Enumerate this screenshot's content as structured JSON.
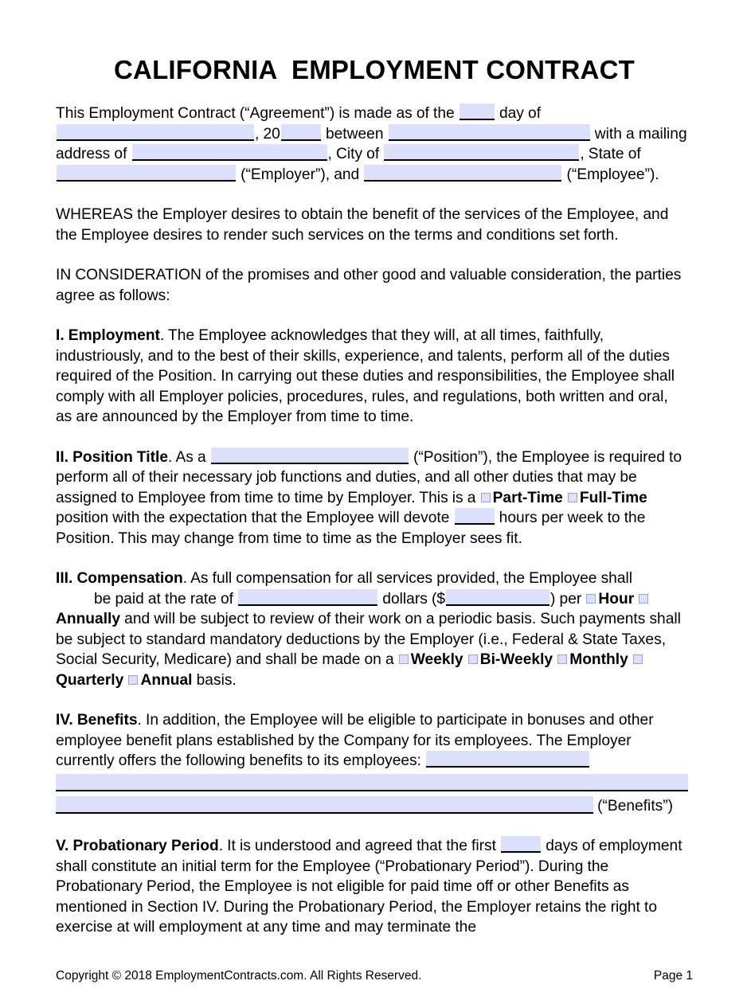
{
  "document": {
    "title": "CALIFORNIA  EMPLOYMENT CONTRACT",
    "state": "CALIFORNIA",
    "doc_type": "EMPLOYMENT CONTRACT"
  },
  "intro": {
    "t1": "This Employment Contract (“Agreement”) is made as of the",
    "t2": "day of",
    "t3": ", 20",
    "t4": "between",
    "t5": "with a mailing address of",
    "t6": ", City of",
    "t7": ", State of",
    "t8": "(“Employer”), and",
    "t9": "(“Employee”)."
  },
  "recitals": {
    "whereas": "WHEREAS the Employer desires to obtain the benefit of the services of the Employee, and the Employee desires to render such services on the terms and conditions set forth.",
    "consideration": "IN CONSIDERATION of the promises and other good and valuable consideration, the parties agree as follows:"
  },
  "sections": {
    "employment": {
      "heading": "I. Employment",
      "t1": ". The Employee acknowledges that they will, at all times, faithfully, industriously, and to the best of their skills, experience, and talents, perform all of the duties required of the Position. In carrying out these duties and responsibilities, the Employee shall comply with all Employer policies, procedures, rules, and regulations, both written and oral, as are announced by the Employer from time to time."
    },
    "position_title": {
      "heading": "II. Position Title",
      "t1": ". As a",
      "t2": "(“Position”), the Employee is required to perform all of their necessary job functions and duties, and all other duties that may be assigned to Employee from time to time by Employer. This is a",
      "opt_part_time": "Part-Time",
      "opt_full_time": "Full-Time",
      "t3": "position with the expectation that the Employee will devote",
      "t4": "hours per week to the Position. This may change from time to time as the Employer sees fit."
    },
    "compensation": {
      "heading": "III. Compensation",
      "t1": ". As full compensation for all services provided, the Employee shall",
      "t2": "be paid at the rate of",
      "t3": "dollars ($",
      "t4": ") per",
      "opt_hour": "Hour",
      "opt_annually": "Annually",
      "t5": "and will be subject to review of their work on a periodic basis. Such payments shall be subject to standard mandatory deductions by the Employer (i.e., Federal & State Taxes, Social Security, Medicare) and shall be made on a",
      "opt_weekly": "Weekly",
      "opt_biweekly": "Bi-Weekly",
      "opt_monthly": "Monthly",
      "opt_quarterly": "Quarterly",
      "opt_annual": "Annual",
      "t6": "basis."
    },
    "benefits": {
      "heading": "IV. Benefits",
      "t1": ". In addition, the Employee will be eligible to participate in bonuses and other employee benefit plans established by the Company for its employees. The Employer currently offers the following benefits to its employees:",
      "t2": "(“Benefits”)"
    },
    "probationary": {
      "heading": "V. Probationary Period",
      "t1": ". It is understood and agreed that the first",
      "t2": "days of employment shall constitute an initial term for the Employee (“Probationary Period”). During the Probationary Period, the Employee is not eligible for paid time off or other Benefits as mentioned in Section IV. During the Probationary Period, the Employer retains the right to exercise at will employment at any time and may terminate the"
    }
  },
  "footer": {
    "copyright": "Copyright © 2018 EmploymentContracts.com. All Rights Reserved.",
    "page": "Page 1"
  },
  "colors": {
    "blank_fill": "#dde0fa",
    "rule": "#000000",
    "checkbox_border": "#9aa3d8",
    "text": "#000000",
    "background": "#ffffff"
  }
}
